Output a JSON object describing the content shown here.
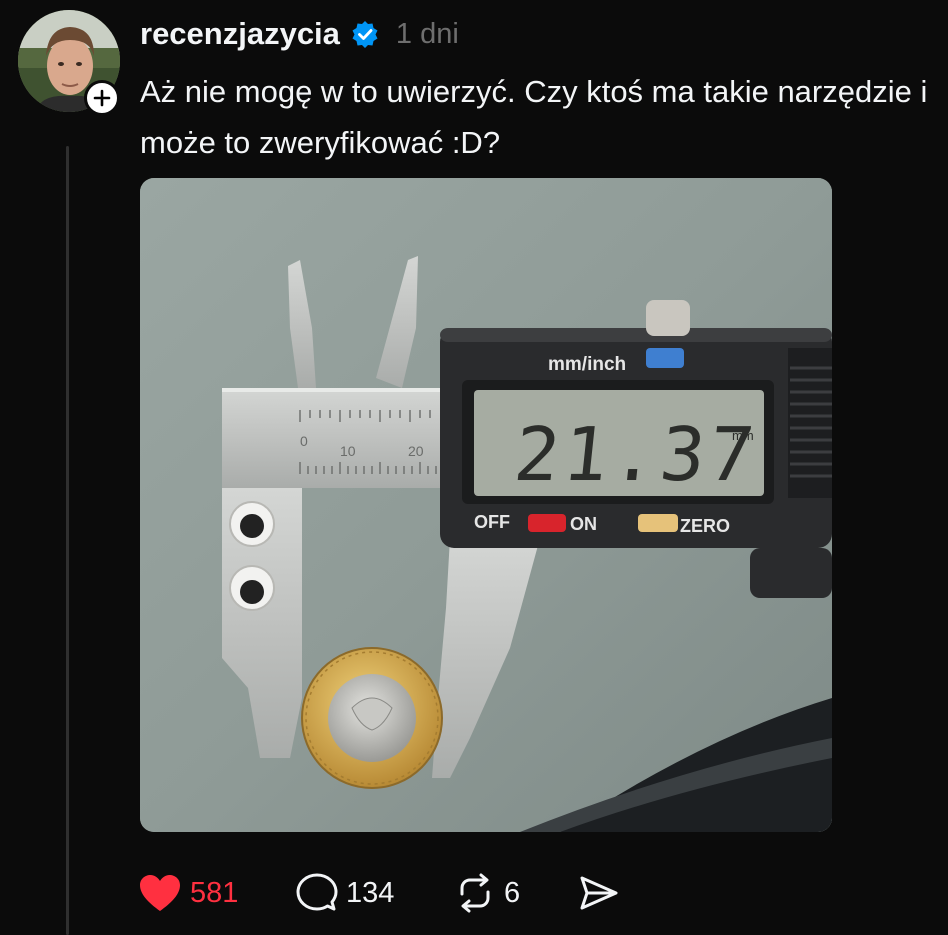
{
  "post": {
    "username": "recenzjazycia",
    "timestamp": "1 dni",
    "text": "Aż nie mogę w to uwierzyć. Czy ktoś ma takie narzędzie i może to zweryfikować :D?",
    "image": {
      "display_reading": "21.37",
      "display_unit": "mm",
      "label_mode": "mm/inch",
      "label_off": "OFF",
      "label_on": "ON",
      "label_zero": "ZERO",
      "scale_10": "10",
      "scale_20": "20",
      "scale_0": "0"
    }
  },
  "actions": {
    "likes": "581",
    "comments": "134",
    "reposts": "6"
  },
  "colors": {
    "background": "#0b0b0b",
    "like": "#ff3040",
    "verified": "#0095f6",
    "muted": "#6e6e6e"
  },
  "icons": [
    "heart-icon",
    "comment-icon",
    "repost-icon",
    "share-icon",
    "verified-icon",
    "plus-icon"
  ]
}
